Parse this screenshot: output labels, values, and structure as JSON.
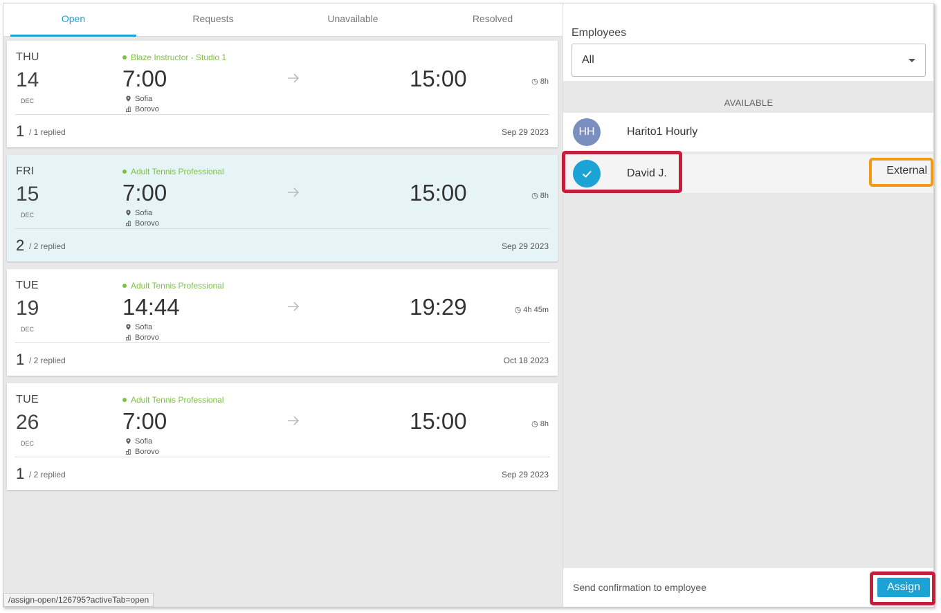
{
  "tabs": [
    {
      "label": "Open",
      "active": true
    },
    {
      "label": "Requests",
      "active": false
    },
    {
      "label": "Unavailable",
      "active": false
    },
    {
      "label": "Resolved",
      "active": false
    }
  ],
  "shifts": [
    {
      "day": "THU",
      "date": "14",
      "month": "DEC",
      "role": "Blaze Instructor - Studio 1",
      "start": "7:00",
      "end": "15:00",
      "duration": "8h",
      "location": "Sofia",
      "area": "Borovo",
      "count": "1",
      "replied": "/ 1 replied",
      "posted": "Sep 29 2023",
      "selected": false
    },
    {
      "day": "FRI",
      "date": "15",
      "month": "DEC",
      "role": "Adult Tennis Professional",
      "start": "7:00",
      "end": "15:00",
      "duration": "8h",
      "location": "Sofia",
      "area": "Borovo",
      "count": "2",
      "replied": "/ 2 replied",
      "posted": "Sep 29 2023",
      "selected": true
    },
    {
      "day": "TUE",
      "date": "19",
      "month": "DEC",
      "role": "Adult Tennis Professional",
      "start": "14:44",
      "end": "19:29",
      "duration": "4h 45m",
      "location": "Sofia",
      "area": "Borovo",
      "count": "1",
      "replied": "/ 2 replied",
      "posted": "Oct 18 2023",
      "selected": false
    },
    {
      "day": "TUE",
      "date": "26",
      "month": "DEC",
      "role": "Adult Tennis Professional",
      "start": "7:00",
      "end": "15:00",
      "duration": "8h",
      "location": "Sofia",
      "area": "Borovo",
      "count": "1",
      "replied": "/ 2 replied",
      "posted": "Sep 29 2023",
      "selected": false
    }
  ],
  "status_url": "/assign-open/126795?activeTab=open",
  "employees": {
    "label": "Employees",
    "selected": "All",
    "section": "AVAILABLE",
    "list": [
      {
        "initials": "HH",
        "name": "Harito1 Hourly",
        "tag": "",
        "checked": false
      },
      {
        "initials": "",
        "name": "David J.",
        "tag": "External",
        "checked": true
      }
    ]
  },
  "footer": {
    "confirm_label": "Send confirmation to employee",
    "assign_label": "Assign"
  },
  "colors": {
    "accent": "#1aa3d4",
    "role_green": "#7cc242",
    "selected_card": "#e6f4f8",
    "highlight_red": "#c41e3a",
    "highlight_orange": "#f39a12"
  }
}
